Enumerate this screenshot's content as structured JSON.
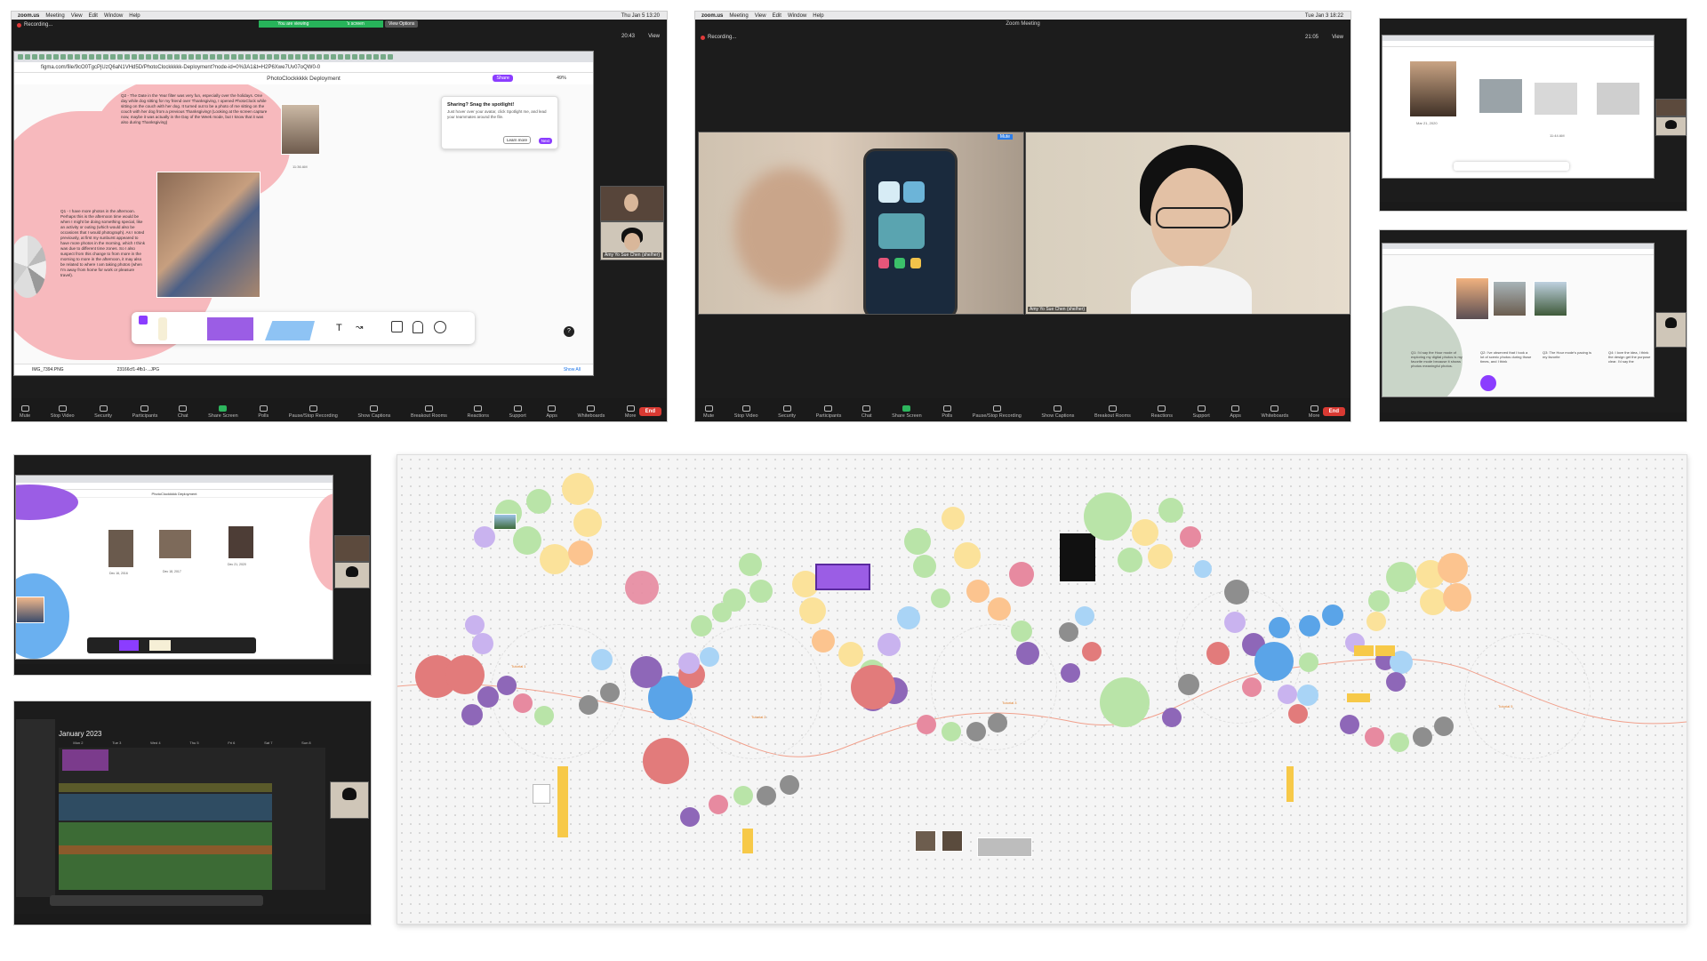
{
  "panel1": {
    "mac_menu": [
      "zoom.us",
      "Meeting",
      "View",
      "Edit",
      "Window",
      "Help"
    ],
    "clock": "Thu Jan 5 13:20",
    "viewing_banner": "You are viewing",
    "screen_label": "'s screen",
    "view_options": "View Options",
    "recording": "Recording...",
    "timer": "20:43",
    "view": "View",
    "url": "figma.com/file/9cO0TgcPjUzQ6aN1VHd5D/PhotoClockkkkk-Deployment?node-id=0%3A1&t=H2P6Xwe7Uv07oQW0-0",
    "file_title": "PhotoClockkkkk Deployment",
    "share": "Share",
    "zoom_pct": "49%",
    "popup_title": "Sharing? Snag the spotlight!",
    "popup_body": "Just hover over your avatar, click Spotlight me, and lead your teammates around the file.",
    "popup_learn": "Learn more",
    "popup_next": "Next",
    "q2_text": "Q2 - The Date in the Year filter was very fun, especially over the holidays. One day while dog sitting for my friend over Thanksgiving, I opened PhotoClock while sitting on the couch with her dog. It turned out to be a photo of me sitting on the couch with her dog from a previous Thanksgiving! (Looking at the screen capture now, maybe it was actually in the Day of the Week mode, but I know that it was also during Thanksgiving)",
    "q1_text": "Q1 - I have more photos in the afternoon. Perhaps this is the afternoon time would be when I might be doing something special, like an activity or outing (which would also be occasions that I would photograph). As I noted previously, at first my sunburst appeared to have more photos in the morning, which I think was due to different time zones. So I also suspect from this change to from more in the morning to more in the afternoon, it may also be related to where I am taking photos (when I'm away from home for work or pleasure travel).",
    "card_caption": "11:36 AM",
    "download1": "IMG_7394.PNG",
    "download2": "23166cf1-4fb1-...JPG",
    "show_all": "Show All",
    "participant_name": "Amy Yo Sue Chen (she/her)",
    "help": "?"
  },
  "panel2": {
    "title": "Zoom Meeting",
    "clock": "Tue Jan 3 18:22",
    "recording": "Recording...",
    "timer": "21:05",
    "view": "View",
    "mute_tag": "Mute",
    "participant_name": "Amy Yo Sue Chen (she/her)"
  },
  "zoom_controls": [
    {
      "label": "Mute",
      "kind": "mic"
    },
    {
      "label": "Stop Video",
      "kind": "video"
    },
    {
      "label": "Security",
      "kind": "shield"
    },
    {
      "label": "Participants",
      "kind": "people"
    },
    {
      "label": "Chat",
      "kind": "chat"
    },
    {
      "label": "Share Screen",
      "kind": "share",
      "green": true
    },
    {
      "label": "Polls",
      "kind": "polls"
    },
    {
      "label": "Pause/Stop Recording",
      "kind": "rec"
    },
    {
      "label": "Show Captions",
      "kind": "cc"
    },
    {
      "label": "Breakout Rooms",
      "kind": "rooms"
    },
    {
      "label": "Reactions",
      "kind": "smile"
    },
    {
      "label": "Support",
      "kind": "help"
    },
    {
      "label": "Apps",
      "kind": "apps"
    },
    {
      "label": "Whiteboards",
      "kind": "board"
    },
    {
      "label": "More",
      "kind": "more"
    }
  ],
  "end_label": "End",
  "panel3": {
    "date1": "Mar 21, 2020",
    "time1": "11:44 AM"
  },
  "panel4": {
    "q1": "Q1: I'd say the Hour mode of exploring my digital photos is my favorite mode because it shows photos meaningful photos.",
    "q2": "Q2: I've observed that I took a lot of scenic photos during those times, and I think",
    "q3": "Q3: The Hour mode's pacing is my favorite",
    "q4": "Q4: I love the idea, I think the design get the purpose clear. I'd say the"
  },
  "panel5": {
    "title": "PhotoClockkkkk Deployment",
    "d1": "Dec 16, 2016",
    "d2": "Dec 18, 2017",
    "d3": "Dec 21, 2020"
  },
  "panel6": {
    "month": "January 2023",
    "days": [
      "Mon 2",
      "Tue 3",
      "Wed 4",
      "Thu 5",
      "Fri 6",
      "Sat 7",
      "Sun 8"
    ]
  },
  "board": {
    "orange_labels": [
      "Tutorial 1",
      "Tutorial 2",
      "Tutorial 3",
      "Tutorial 4",
      "Tutorial 5"
    ],
    "colors": {
      "green": "#b9e4a8",
      "yellow": "#fbe29a",
      "orange": "#fcc48f",
      "pink": "#e78aa0",
      "purple": "#8e67b8",
      "red": "#e27b7b",
      "blue": "#5aa4e8",
      "grey": "#8e8e8e",
      "lavender": "#c9b3ef",
      "lightblue": "#a9d4f6"
    }
  }
}
